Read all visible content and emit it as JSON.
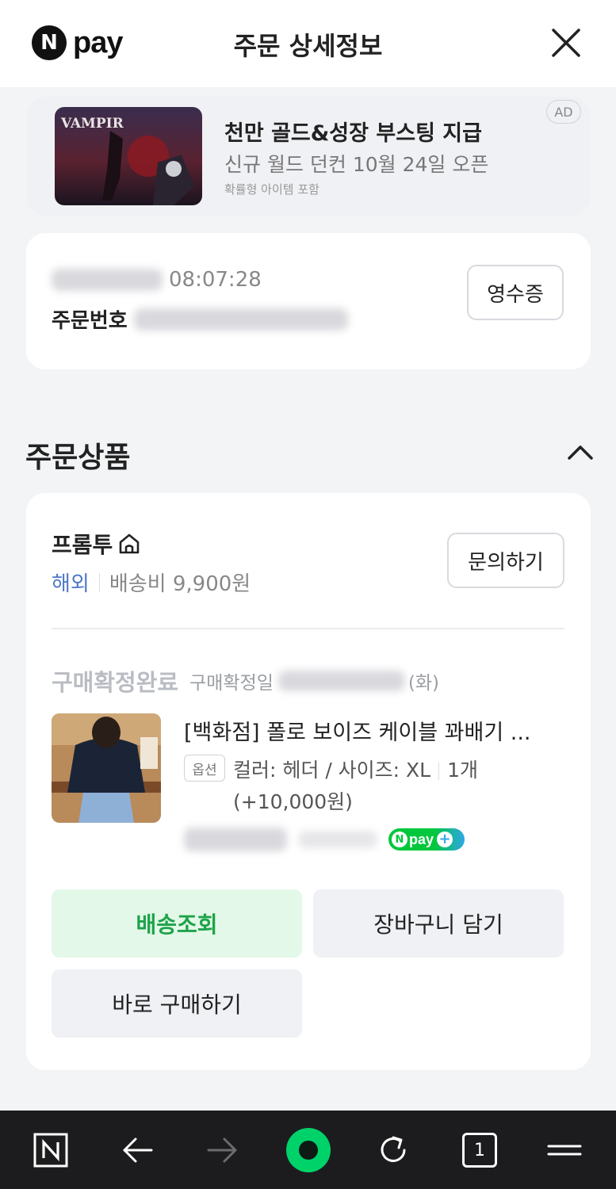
{
  "header": {
    "logo_letter": "N",
    "logo_text": "pay",
    "title": "주문 상세정보",
    "close_icon": "close-icon"
  },
  "ad": {
    "title": "천만 골드&성장 부스팅 지급",
    "subtitle": "신규 월드 던컨 10월 24일 오픈",
    "note": "확률형 아이템 포함",
    "badge": "AD",
    "image_text": "VAMPIR"
  },
  "order": {
    "time": "08:07:28",
    "order_no_label": "주문번호",
    "receipt_label": "영수증"
  },
  "section": {
    "title": "주문상품",
    "collapse_icon": "chevron-up-icon"
  },
  "seller": {
    "name": "프롬투",
    "store_icon": "home-icon",
    "region": "해외",
    "shipping": "배송비 9,900원",
    "inquiry_label": "문의하기"
  },
  "product": {
    "status": "구매확정완료",
    "status_date_label": "구매확정일",
    "status_day": "(화)",
    "name": "[백화점] 폴로 보이즈 케이블 꽈배기 ...",
    "option_badge": "옵션",
    "option_text": "컬러: 헤더 / 사이즈: XL",
    "quantity": "1개 (+10,000원)",
    "npay_plus": "pay"
  },
  "actions": {
    "track": "배송조회",
    "cart": "장바구니 담기",
    "buy": "바로 구매하기"
  },
  "bottom_nav": {
    "tab_count": "1",
    "icons": [
      "naver-home-icon",
      "back-arrow-icon",
      "forward-arrow-icon",
      "green-dot-icon",
      "refresh-icon",
      "tabs-icon",
      "menu-icon"
    ]
  },
  "colors": {
    "naver_green": "#00c73c",
    "track_bg": "#e3f8e8",
    "track_text": "#1ea34a",
    "region_blue": "#4f78c8",
    "page_bg": "#f3f4f6",
    "bottom_bar": "#1c1c1e"
  }
}
